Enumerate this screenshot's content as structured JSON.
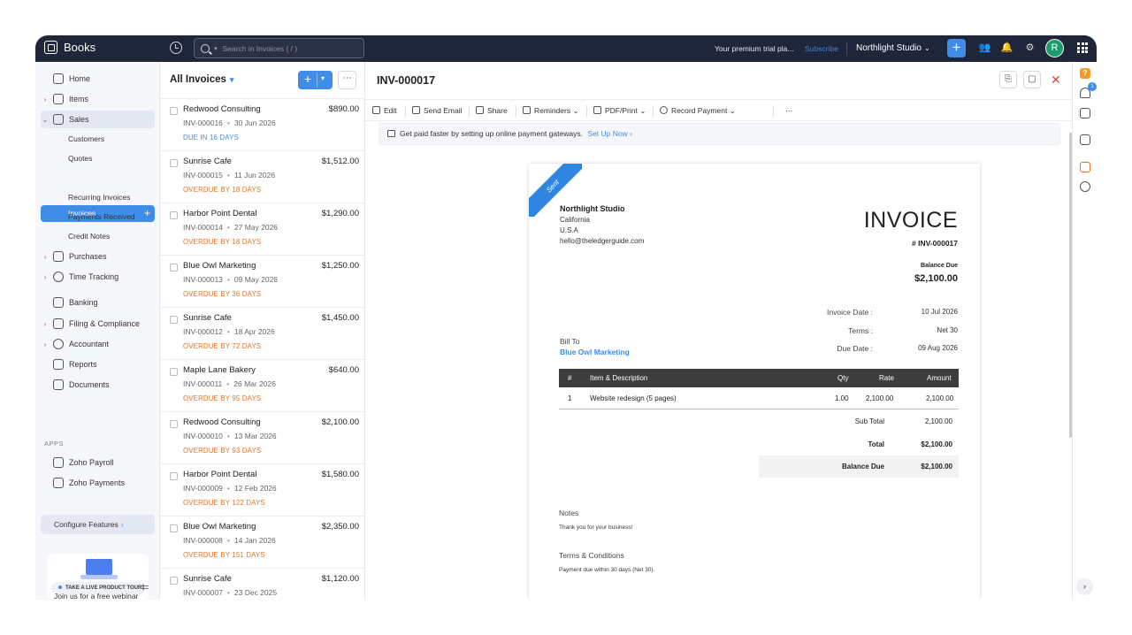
{
  "app": {
    "name": "Books"
  },
  "topbar": {
    "search_placeholder": "Search in Invoices ( / )",
    "trial_text": "Your premium trial pla...",
    "subscribe_label": "Subscribe",
    "org_name": "Northlight Studio",
    "avatar_initial": "R"
  },
  "sidebar": {
    "items": [
      {
        "label": "Home"
      },
      {
        "label": "Items"
      },
      {
        "label": "Sales"
      },
      {
        "label": "Purchases"
      },
      {
        "label": "Time Tracking"
      },
      {
        "label": "Banking"
      },
      {
        "label": "Filing & Compliance"
      },
      {
        "label": "Accountant"
      },
      {
        "label": "Reports"
      },
      {
        "label": "Documents"
      }
    ],
    "sales_sub": [
      {
        "label": "Customers"
      },
      {
        "label": "Quotes"
      },
      {
        "label": "Invoices"
      },
      {
        "label": "Recurring Invoices"
      },
      {
        "label": "Payments Received"
      },
      {
        "label": "Credit Notes"
      }
    ],
    "apps_label": "APPS",
    "apps": [
      {
        "label": "Zoho Payroll"
      },
      {
        "label": "Zoho Payments"
      }
    ],
    "configure_label": "Configure Features",
    "tour_label": "TAKE A LIVE PRODUCT TOUR",
    "webinar_text": "Join us for a free webinar"
  },
  "list": {
    "title": "All Invoices",
    "rows": [
      {
        "customer": "Redwood Consulting",
        "amount": "$890.00",
        "number": "INV-000016",
        "date": "30 Jun 2026",
        "status": "DUE IN 16 DAYS",
        "status_type": "due"
      },
      {
        "customer": "Sunrise Cafe",
        "amount": "$1,512.00",
        "number": "INV-000015",
        "date": "11 Jun 2026",
        "status": "OVERDUE BY 18 DAYS",
        "status_type": "overdue"
      },
      {
        "customer": "Harbor Point Dental",
        "amount": "$1,290.00",
        "number": "INV-000014",
        "date": "27 May 2026",
        "status": "OVERDUE BY 18 DAYS",
        "status_type": "overdue"
      },
      {
        "customer": "Blue Owl Marketing",
        "amount": "$1,250.00",
        "number": "INV-000013",
        "date": "09 May 2026",
        "status": "OVERDUE BY 36 DAYS",
        "status_type": "overdue"
      },
      {
        "customer": "Sunrise Cafe",
        "amount": "$1,450.00",
        "number": "INV-000012",
        "date": "18 Apr 2026",
        "status": "OVERDUE BY 72 DAYS",
        "status_type": "overdue"
      },
      {
        "customer": "Maple Lane Bakery",
        "amount": "$640.00",
        "number": "INV-000011",
        "date": "26 Mar 2026",
        "status": "OVERDUE BY 95 DAYS",
        "status_type": "overdue"
      },
      {
        "customer": "Redwood Consulting",
        "amount": "$2,100.00",
        "number": "INV-000010",
        "date": "13 Mar 2026",
        "status": "OVERDUE BY 93 DAYS",
        "status_type": "overdue"
      },
      {
        "customer": "Harbor Point Dental",
        "amount": "$1,580.00",
        "number": "INV-000009",
        "date": "12 Feb 2026",
        "status": "OVERDUE BY 122 DAYS",
        "status_type": "overdue"
      },
      {
        "customer": "Blue Owl Marketing",
        "amount": "$2,350.00",
        "number": "INV-000008",
        "date": "14 Jan 2026",
        "status": "OVERDUE BY 151 DAYS",
        "status_type": "overdue"
      },
      {
        "customer": "Sunrise Cafe",
        "amount": "$1,120.00",
        "number": "INV-000007",
        "date": "23 Dec 2025",
        "status": "",
        "status_type": "overdue"
      }
    ]
  },
  "detail": {
    "title": "INV-000017",
    "toolbar": {
      "edit": "Edit",
      "send_email": "Send Email",
      "share": "Share",
      "reminders": "Reminders",
      "pdf_print": "PDF/Print",
      "record_payment": "Record Payment"
    },
    "banner_text": "Get paid faster by setting up online payment gateways.",
    "banner_link": "Set Up Now",
    "invoice": {
      "ribbon": "Sent",
      "org_name": "Northlight Studio",
      "org_region": "California",
      "org_country": "U.S.A",
      "org_email": "hello@theledgerguide.com",
      "heading": "INVOICE",
      "number": "# INV-000017",
      "balance_due_label": "Balance Due",
      "balance_due": "$2,100.00",
      "invoice_date_label": "Invoice Date :",
      "invoice_date": "10 Jul 2026",
      "terms_label": "Terms :",
      "terms": "Net 30",
      "due_date_label": "Due Date :",
      "due_date": "09 Aug 2026",
      "bill_to_label": "Bill To",
      "bill_to": "Blue Owl Marketing",
      "columns": {
        "num": "#",
        "item": "Item & Description",
        "qty": "Qty",
        "rate": "Rate",
        "amount": "Amount"
      },
      "items": [
        {
          "num": "1",
          "item": "Website redesign (5 pages)",
          "qty": "1.00",
          "rate": "2,100.00",
          "amount": "2,100.00"
        }
      ],
      "sub_total_label": "Sub Total",
      "sub_total": "2,100.00",
      "total_label": "Total",
      "total": "$2,100.00",
      "balance_label": "Balance Due",
      "balance": "$2,100.00",
      "notes_label": "Notes",
      "notes": "Thank you for your business!",
      "terms_conditions_label": "Terms & Conditions",
      "terms_conditions": "Payment due within 30 days (Net 30)."
    }
  },
  "colors": {
    "primary": "#3f8de8",
    "topbar": "#20263a",
    "overdue": "#e67324",
    "accent_green": "#1b9c6a"
  }
}
